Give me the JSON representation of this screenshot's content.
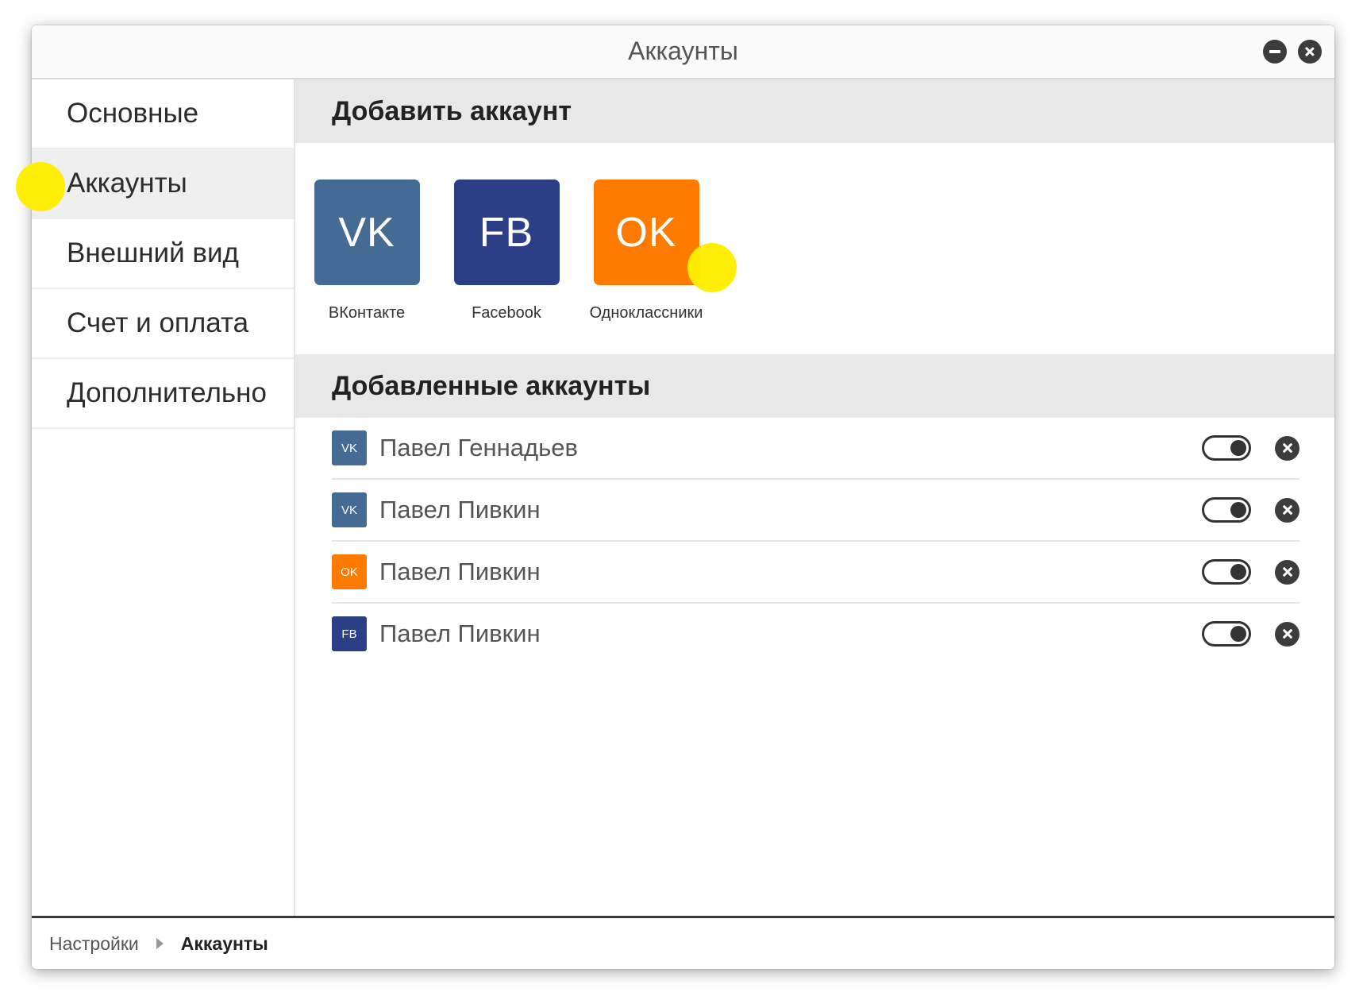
{
  "window": {
    "title": "Аккаунты",
    "minimize_icon": "minimize-icon",
    "close_icon": "close-icon"
  },
  "sidebar": {
    "items": [
      {
        "label": "Основные",
        "active": false
      },
      {
        "label": "Аккаунты",
        "active": true
      },
      {
        "label": "Внешний вид",
        "active": false
      },
      {
        "label": "Счет и оплата",
        "active": false
      },
      {
        "label": "Дополнительно",
        "active": false
      }
    ]
  },
  "add_section": {
    "title": "Добавить аккаунт",
    "tiles": [
      {
        "abbr": "VK",
        "label": "ВКонтакте",
        "color": "#456b94"
      },
      {
        "abbr": "FB",
        "label": "Facebook",
        "color": "#2c3f86"
      },
      {
        "abbr": "OK",
        "label": "Одноклассники",
        "color": "#ff7b00"
      }
    ]
  },
  "added_section": {
    "title": "Добавленные аккаунты",
    "accounts": [
      {
        "network": "VK",
        "name": "Павел Геннадьев",
        "enabled": true
      },
      {
        "network": "VK",
        "name": "Павел Пивкин",
        "enabled": true
      },
      {
        "network": "OK",
        "name": "Павел Пивкин",
        "enabled": true
      },
      {
        "network": "FB",
        "name": "Павел Пивкин",
        "enabled": true
      }
    ]
  },
  "breadcrumb": {
    "root": "Настройки",
    "current": "Аккаунты"
  },
  "colors": {
    "vk": "#456b94",
    "fb": "#2c3f86",
    "ok": "#ff7b00",
    "highlight_marker": "#ffee00"
  }
}
